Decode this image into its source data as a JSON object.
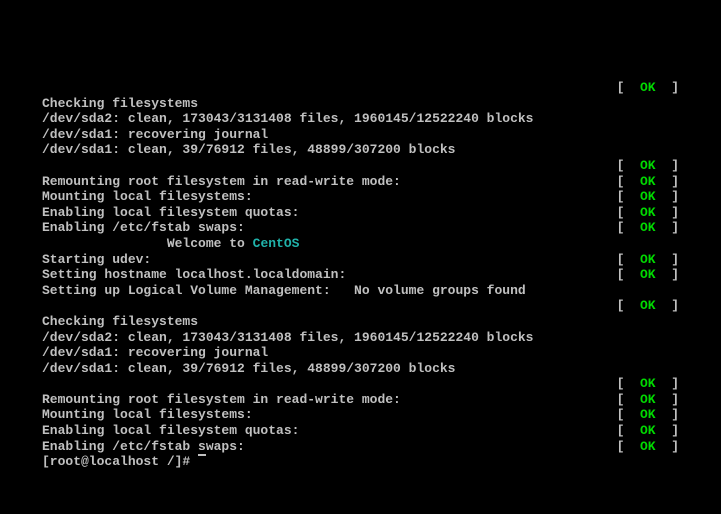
{
  "status_prefix": "[  ",
  "status_suffix": "  ]",
  "ok": "OK",
  "welcome_prefix": "                Welcome to ",
  "welcome_os": "CentOS",
  "prompt": "[root@localhost /]# ",
  "lines": [
    {
      "type": "status_only"
    },
    {
      "type": "text",
      "text": "Checking filesystems"
    },
    {
      "type": "text",
      "text": "/dev/sda2: clean, 173043/3131408 files, 1960145/12522240 blocks"
    },
    {
      "type": "text",
      "text": "/dev/sda1: recovering journal"
    },
    {
      "type": "text",
      "text": "/dev/sda1: clean, 39/76912 files, 48899/307200 blocks"
    },
    {
      "type": "status_only"
    },
    {
      "type": "msg_status",
      "text": "Remounting root filesystem in read-write mode:"
    },
    {
      "type": "msg_status",
      "text": "Mounting local filesystems:"
    },
    {
      "type": "msg_status",
      "text": "Enabling local filesystem quotas:"
    },
    {
      "type": "msg_status",
      "text": "Enabling /etc/fstab swaps:"
    },
    {
      "type": "welcome"
    },
    {
      "type": "msg_status",
      "text": "Starting udev:"
    },
    {
      "type": "msg_status",
      "text": "Setting hostname localhost.localdomain:"
    },
    {
      "type": "text",
      "text": "Setting up Logical Volume Management:   No volume groups found"
    },
    {
      "type": "status_only"
    },
    {
      "type": "text",
      "text": "Checking filesystems"
    },
    {
      "type": "text",
      "text": "/dev/sda2: clean, 173043/3131408 files, 1960145/12522240 blocks"
    },
    {
      "type": "text",
      "text": "/dev/sda1: recovering journal"
    },
    {
      "type": "text",
      "text": "/dev/sda1: clean, 39/76912 files, 48899/307200 blocks"
    },
    {
      "type": "status_only"
    },
    {
      "type": "msg_status",
      "text": "Remounting root filesystem in read-write mode:"
    },
    {
      "type": "msg_status",
      "text": "Mounting local filesystems:"
    },
    {
      "type": "msg_status",
      "text": "Enabling local filesystem quotas:"
    },
    {
      "type": "msg_status",
      "text": "Enabling /etc/fstab swaps:"
    },
    {
      "type": "prompt"
    }
  ]
}
